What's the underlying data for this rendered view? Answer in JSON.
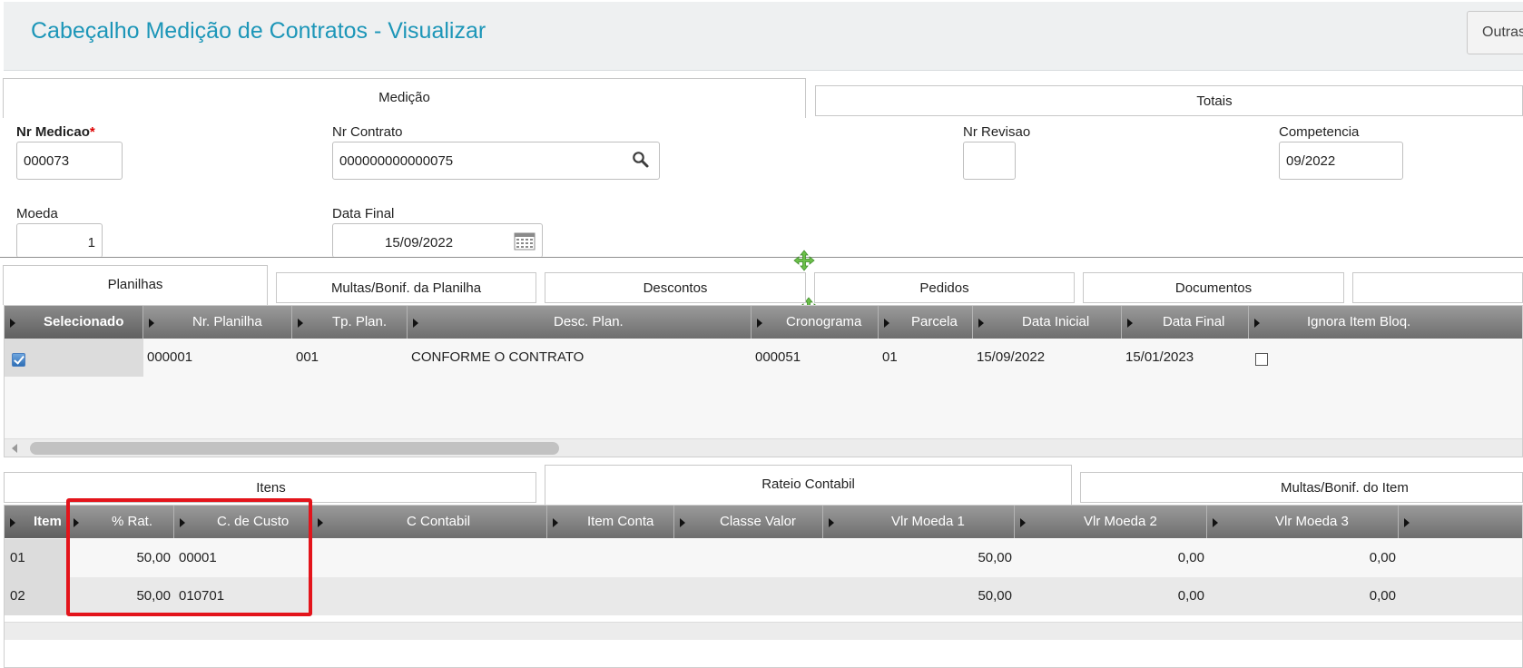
{
  "header": {
    "title": "Cabeçalho Medição de Contratos - Visualizar",
    "outras_label": "Outras"
  },
  "top_tabs": {
    "medicao": "Medição",
    "totais": "Totais"
  },
  "form": {
    "nr_medicao": {
      "label": "Nr Medicao",
      "required_mark": "*",
      "value": "000073"
    },
    "nr_contrato": {
      "label": "Nr Contrato",
      "value": "000000000000075"
    },
    "nr_revisao": {
      "label": "Nr Revisao",
      "value": ""
    },
    "competencia": {
      "label": "Competencia",
      "value": "09/2022"
    },
    "moeda": {
      "label": "Moeda",
      "value": "1"
    },
    "data_final": {
      "label": "Data Final",
      "value": "15/09/2022"
    }
  },
  "mid_tabs": {
    "planilhas": "Planilhas",
    "multas": "Multas/Bonif. da Planilha",
    "descontos": "Descontos",
    "pedidos": "Pedidos",
    "documentos": "Documentos"
  },
  "planilhas_grid": {
    "columns": [
      "Selecionado",
      "Nr. Planilha",
      "Tp. Plan.",
      "Desc. Plan.",
      "Cronograma",
      "Parcela",
      "Data Inicial",
      "Data Final",
      "Ignora Item Bloq."
    ],
    "rows": [
      {
        "selecionado": true,
        "nr_planilha": "000001",
        "tp_plan": "001",
        "desc_plan": "CONFORME O CONTRATO",
        "cronograma": "000051",
        "parcela": "01",
        "data_inicial": "15/09/2022",
        "data_final": "15/01/2023",
        "ignora": false
      }
    ]
  },
  "bottom_tabs": {
    "itens": "Itens",
    "rateio": "Rateio Contabil",
    "multas_item": "Multas/Bonif. do Item"
  },
  "rateio_grid": {
    "columns": [
      "Item",
      "% Rat.",
      "C. de Custo",
      "C Contabil",
      "Item Conta",
      "Classe Valor",
      "Vlr Moeda 1",
      "Vlr Moeda 2",
      "Vlr Moeda 3"
    ],
    "rows": [
      {
        "item": "01",
        "rat": "50,00",
        "custo": "00001",
        "contabil": "",
        "item_conta": "",
        "classe": "",
        "vlr1": "50,00",
        "vlr2": "0,00",
        "vlr3": "0,00"
      },
      {
        "item": "02",
        "rat": "50,00",
        "custo": "010701",
        "contabil": "",
        "item_conta": "",
        "classe": "",
        "vlr1": "50,00",
        "vlr2": "0,00",
        "vlr3": "0,00"
      }
    ]
  },
  "colors": {
    "title": "#1c96b8",
    "header_bar": "#7d7d7d",
    "highlight": "#e3141b",
    "move_handle": "#6cc04a"
  }
}
